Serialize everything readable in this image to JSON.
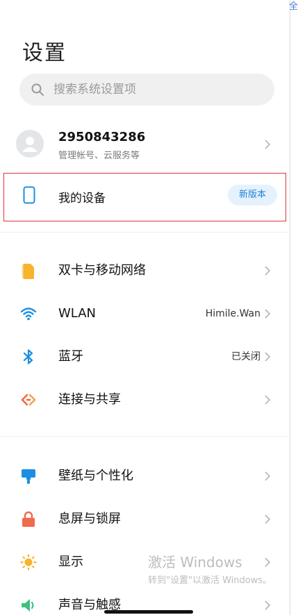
{
  "header": {
    "title": "设置",
    "edge_glyph": "全"
  },
  "search": {
    "placeholder": "搜索系统设置项",
    "icon": "search-icon"
  },
  "account": {
    "name": "2950843286",
    "subtitle": "管理帐号、云服务等",
    "icon": "avatar-icon"
  },
  "device": {
    "label": "我的设备",
    "badge": "新版本",
    "icon": "phone-icon",
    "highlight_color": "#d9353f"
  },
  "groups": [
    {
      "items": [
        {
          "label": "双卡与移动网络",
          "value": "",
          "icon": "sim-card-icon",
          "color": "#f7b42c"
        },
        {
          "label": "WLAN",
          "value": "Himile.Wan",
          "icon": "wifi-icon",
          "color": "#1c8fe3"
        },
        {
          "label": "蓝牙",
          "value": "已关闭",
          "icon": "bluetooth-icon",
          "color": "#1c8fe3"
        },
        {
          "label": "连接与共享",
          "value": "",
          "icon": "share-icon",
          "color": "#f06a3a"
        }
      ]
    },
    {
      "items": [
        {
          "label": "壁纸与个性化",
          "value": "",
          "icon": "wallpaper-icon",
          "color": "#1c8fe3"
        },
        {
          "label": "息屏与锁屏",
          "value": "",
          "icon": "lock-icon",
          "color": "#f06a4e"
        },
        {
          "label": "显示",
          "value": "",
          "icon": "brightness-icon",
          "color": "#f7b42c"
        },
        {
          "label": "声音与触感",
          "value": "",
          "icon": "sound-icon",
          "color": "#3ac27e"
        }
      ]
    }
  ],
  "watermark": {
    "line1": "激活 Windows",
    "line2": "转到\"设置\"以激活 Windows。"
  }
}
